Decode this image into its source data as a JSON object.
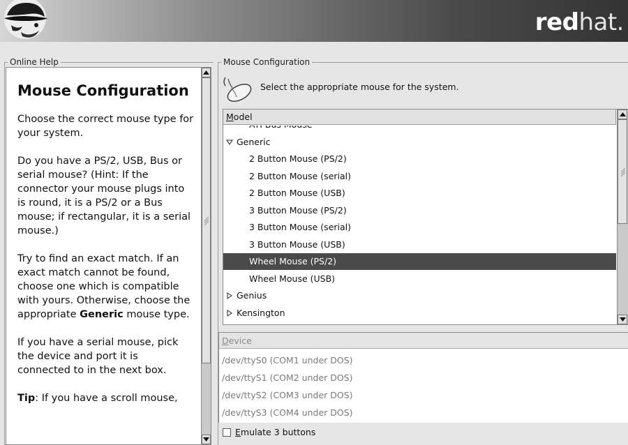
{
  "header": {
    "brand_bold": "red",
    "brand_light": "hat."
  },
  "help": {
    "frame_label": "Online Help",
    "title": "Mouse Configuration",
    "para1": "Choose the correct mouse type for your system.",
    "para2": "Do you have a PS/2, USB, Bus or serial mouse? (Hint: If the connector your mouse plugs into is round, it is a PS/2 or a Bus mouse; if rectangular, it is a serial mouse.)",
    "para3_pre": "Try to find an exact match. If an exact match cannot be found, choose one which is compatible with yours. Otherwise, choose the appropriate ",
    "para3_bold": "Generic",
    "para3_post": " mouse type.",
    "para4": "If you have a serial mouse, pick the device and port it is connected to in the next box.",
    "tip_bold": "Tip",
    "tip_rest": ": If you have a scroll mouse,"
  },
  "mouse": {
    "frame_label": "Mouse Configuration",
    "prompt": "Select the appropriate mouse for the system.",
    "model_header": "Model",
    "rows": [
      {
        "label": "ATI Bus Mouse",
        "indent": 1,
        "expander": "none",
        "selected": false
      },
      {
        "label": "Generic",
        "indent": 0,
        "expander": "expanded",
        "selected": false
      },
      {
        "label": "2 Button Mouse (PS/2)",
        "indent": 1,
        "expander": "none",
        "selected": false
      },
      {
        "label": "2 Button Mouse (serial)",
        "indent": 1,
        "expander": "none",
        "selected": false
      },
      {
        "label": "2 Button Mouse (USB)",
        "indent": 1,
        "expander": "none",
        "selected": false
      },
      {
        "label": "3 Button Mouse (PS/2)",
        "indent": 1,
        "expander": "none",
        "selected": false
      },
      {
        "label": "3 Button Mouse (serial)",
        "indent": 1,
        "expander": "none",
        "selected": false
      },
      {
        "label": "3 Button Mouse (USB)",
        "indent": 1,
        "expander": "none",
        "selected": false
      },
      {
        "label": "Wheel Mouse (PS/2)",
        "indent": 1,
        "expander": "none",
        "selected": true
      },
      {
        "label": "Wheel Mouse (USB)",
        "indent": 1,
        "expander": "none",
        "selected": false
      },
      {
        "label": "Genius",
        "indent": 0,
        "expander": "collapsed",
        "selected": false
      },
      {
        "label": "Kensington",
        "indent": 0,
        "expander": "collapsed",
        "selected": false
      }
    ],
    "device_header": "Device",
    "devices": [
      "/dev/ttyS0 (COM1 under DOS)",
      "/dev/ttyS1 (COM2 under DOS)",
      "/dev/ttyS2 (COM3 under DOS)",
      "/dev/ttyS3 (COM4 under DOS)"
    ],
    "emulate_label": "Emulate 3 buttons",
    "emulate_checked": false
  }
}
